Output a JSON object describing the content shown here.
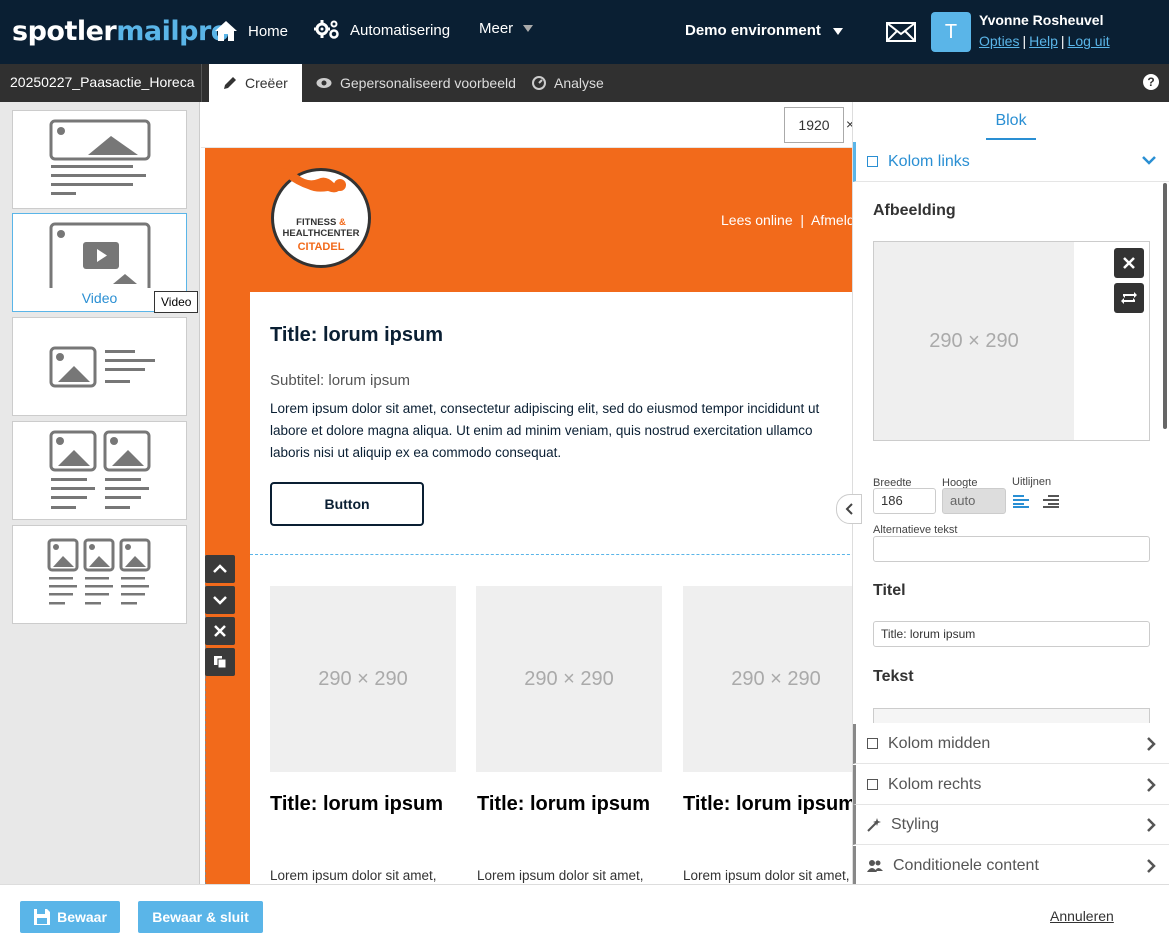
{
  "topbar": {
    "logo_a": "spotler",
    "logo_b": "mailpro",
    "nav": [
      {
        "label": "Home",
        "icon": "home-icon"
      },
      {
        "label": "Automatisering",
        "icon": "gears-icon"
      },
      {
        "label": "Meer",
        "icon": "caret-down-icon"
      }
    ],
    "environment": "Demo environment",
    "avatar_initial": "T",
    "user_name": "Yvonne Rosheuvel",
    "links": [
      "Opties",
      "Help",
      "Log uit"
    ],
    "sep": "|"
  },
  "subbar": {
    "campaign": "20250227_Paasactie_Horeca",
    "tabs": [
      "Creëer",
      "Gepersonaliseerd voorbeeld",
      "Analyse"
    ],
    "help": "?"
  },
  "leftbar": {
    "selected_label": "Video",
    "tooltip": "Video"
  },
  "canvas": {
    "width_value": "1920",
    "width_x": "×",
    "header_links": "Lees online  |  Afmelden",
    "logo_line1": "FITNESS",
    "logo_amp": "&",
    "logo_line2": "HEALTHCENTER",
    "logo_line3": "CITADEL",
    "title": "Title: lorum ipsum",
    "subtitle": "Subtitel: lorum ipsum",
    "body": "Lorem ipsum dolor sit amet, consectetur adipiscing elit, sed do eiusmod tempor incididunt ut labore et dolore magna aliqua. Ut enim ad minim veniam, quis nostrud exercitation ullamco laboris nisi ut aliquip ex ea commodo consequat.",
    "button": "Button",
    "columns": [
      {
        "placeholder": "290 × 290",
        "title": "Title: lorum ipsum",
        "text": "Lorem ipsum dolor sit amet,"
      },
      {
        "placeholder": "290 × 290",
        "title": "Title: lorum ipsum",
        "text": "Lorem ipsum dolor sit amet,"
      },
      {
        "placeholder": "290 × 290",
        "title": "Title: lorum ipsum",
        "text": "Lorem ipsum dolor sit amet,"
      }
    ]
  },
  "rightpanel": {
    "tab": "Blok",
    "open_section": "Kolom links",
    "afbeelding_title": "Afbeelding",
    "image_placeholder": "290 × 290",
    "breedte_label": "Breedte",
    "breedte_value": "186",
    "hoogte_label": "Hoogte",
    "hoogte_value": "auto",
    "uitlijnen_label": "Uitlijnen",
    "alt_label": "Alternatieve tekst",
    "alt_value": "",
    "titel_title": "Titel",
    "titel_value": "Title: lorum ipsum",
    "tekst_title": "Tekst",
    "sections": [
      "Kolom midden",
      "Kolom rechts",
      "Styling",
      "Conditionele content"
    ]
  },
  "bottombar": {
    "save": "Bewaar",
    "save_close": "Bewaar & sluit",
    "cancel": "Annuleren"
  },
  "colors": {
    "nav_bg": "#0a1f33",
    "accent": "#5ab5e8",
    "email_orange": "#f26a1b"
  }
}
